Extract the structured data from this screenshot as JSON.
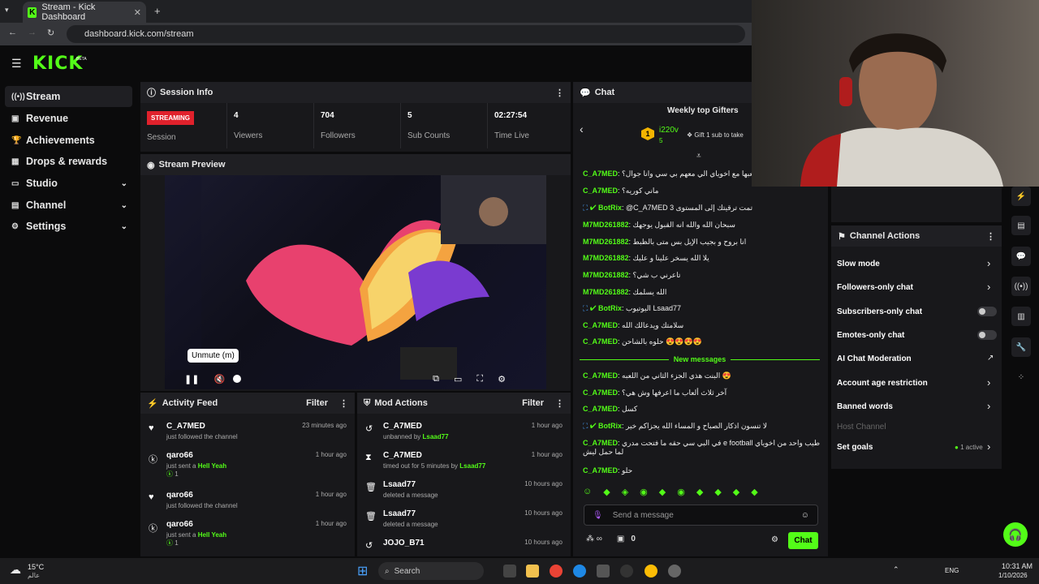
{
  "browser": {
    "tab_title": "Stream - Kick Dashboard",
    "url": "dashboard.kick.com/stream"
  },
  "logo": "KICK",
  "logo_sup": "BETA",
  "sidebar": {
    "items": [
      {
        "label": "Stream",
        "icon": "broadcast-icon"
      },
      {
        "label": "Revenue",
        "icon": "revenue-icon"
      },
      {
        "label": "Achievements",
        "icon": "trophy-icon"
      },
      {
        "label": "Drops & rewards",
        "icon": "gift-icon"
      },
      {
        "label": "Studio",
        "icon": "studio-icon"
      },
      {
        "label": "Channel",
        "icon": "channel-icon"
      },
      {
        "label": "Settings",
        "icon": "gear-icon"
      }
    ]
  },
  "session": {
    "title": "Session Info",
    "badge": "STREAMING",
    "label": "Session",
    "stats": [
      {
        "value": "4",
        "label": "Viewers"
      },
      {
        "value": "704",
        "label": "Followers"
      },
      {
        "value": "5",
        "label": "Sub Counts"
      },
      {
        "value": "02:27:54",
        "label": "Time Live"
      }
    ]
  },
  "preview": {
    "title": "Stream Preview",
    "tooltip": "Unmute (m)"
  },
  "activity": {
    "title": "Activity Feed",
    "filter": "Filter",
    "items": [
      {
        "name": "C_A7MED",
        "desc": "just followed the channel",
        "time": "23 minutes ago"
      },
      {
        "name": "qaro66",
        "desc": "just sent a",
        "extra": "Hell Yeah",
        "count": "1",
        "time": "1 hour ago"
      },
      {
        "name": "qaro66",
        "desc": "just followed the channel",
        "time": "1 hour ago"
      },
      {
        "name": "qaro66",
        "desc": "just sent a",
        "extra": "Hell Yeah",
        "count": "1",
        "time": "1 hour ago"
      }
    ]
  },
  "mod": {
    "title": "Mod Actions",
    "filter": "Filter",
    "items": [
      {
        "name": "C_A7MED",
        "desc": "unbanned by",
        "by": "Lsaad77",
        "time": "1 hour ago"
      },
      {
        "name": "C_A7MED",
        "desc": "timed out for 5 minutes by",
        "by": "Lsaad77",
        "time": "1 hour ago"
      },
      {
        "name": "Lsaad77",
        "desc": "deleted a message",
        "time": "10 hours ago"
      },
      {
        "name": "Lsaad77",
        "desc": "deleted a message",
        "time": "10 hours ago"
      },
      {
        "name": "JOJO_B71",
        "desc": "",
        "time": "10 hours ago"
      }
    ]
  },
  "chat": {
    "title": "Chat",
    "gifters_title": "Weekly top Gifters",
    "gifter_rank": "1",
    "gifter_name": "i220v",
    "gifter_count": "5",
    "gift_cta": "Gift 1 sub to take",
    "lines": [
      {
        "user": "C_A7MED",
        "msg": "أنا أقدر العبها مع اخوياي الي معهم بي سي وانا جوال؟"
      },
      {
        "user": "C_A7MED",
        "msg": "ماني كوريه؟"
      },
      {
        "user": "BotRix",
        "msg": "@C_A7MED 3 تمت ترقيتك إلى المستوى"
      },
      {
        "user": "M7MD261882",
        "msg": "سبحان الله والله انه القبول يوجهك"
      },
      {
        "user": "M7MD261882",
        "msg": "انا بروح و بجيب الإيل بس متى بالظبط"
      },
      {
        "user": "M7MD261882",
        "msg": "يلا الله يسخر علينا و عليك"
      },
      {
        "user": "M7MD261882",
        "msg": "تاعرني ب شي؟"
      },
      {
        "user": "M7MD261882",
        "msg": "الله يسلمك"
      },
      {
        "user": "BotRix",
        "msg": "اليوتيوب Lsaad77"
      },
      {
        "user": "C_A7MED",
        "msg": "سلامتك ويدعالك الله"
      },
      {
        "user": "C_A7MED",
        "msg": "حلوه بالشاحن 😍😍😍😍"
      }
    ],
    "new_messages": "New messages",
    "lines2": [
      {
        "user": "C_A7MED",
        "msg": "البنت هذي الجزء الثاني من اللعبه 😍"
      },
      {
        "user": "C_A7MED",
        "msg": "آخر ثلاث ألعاب ما اعرفها وش هي؟"
      },
      {
        "user": "C_A7MED",
        "msg": "كسل"
      },
      {
        "user": "BotRix",
        "msg": "لا تنسون اذكار الصباح و المساء الله يجزاكم خير"
      },
      {
        "user": "C_A7MED",
        "msg": "في البي سي حقه ما فتحت مدري e football طيب واحد من اخوياي لما حمل"
      },
      {
        "user": "",
        "msg": "ليش"
      },
      {
        "user": "C_A7MED",
        "msg": "حلو"
      }
    ],
    "input_placeholder": "Send a message",
    "points": "0",
    "send": "Chat"
  },
  "channel_actions": {
    "title": "Channel Actions",
    "items": [
      {
        "label": "Slow mode",
        "ctrl": "chevron"
      },
      {
        "label": "Followers-only chat",
        "ctrl": "chevron"
      },
      {
        "label": "Subscribers-only chat",
        "ctrl": "toggle"
      },
      {
        "label": "Emotes-only chat",
        "ctrl": "toggle"
      },
      {
        "label": "AI Chat Moderation",
        "ctrl": "external"
      },
      {
        "label": "Account age restriction",
        "ctrl": "chevron"
      },
      {
        "label": "Banned words",
        "ctrl": "chevron"
      },
      {
        "label": "Host Channel",
        "ctrl": "none"
      },
      {
        "label": "Set goals",
        "ctrl": "chevron",
        "extra": "1 active"
      }
    ]
  },
  "taskbar": {
    "temp": "15°C",
    "weather": "عالم",
    "search": "Search",
    "lang": "ENG",
    "time": "10:31 AM",
    "date": "1/10/2026"
  }
}
